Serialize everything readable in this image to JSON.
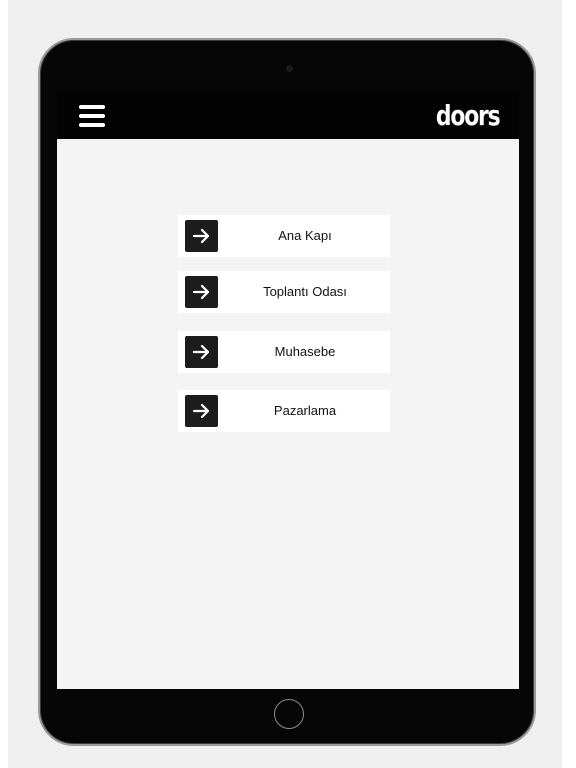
{
  "app": {
    "brand": "doors"
  },
  "header": {
    "menu_icon": "hamburger-menu-icon"
  },
  "doors": [
    {
      "label": "Ana Kapı",
      "icon": "arrow-right-icon"
    },
    {
      "label": "Toplantı Odası",
      "icon": "arrow-right-icon"
    },
    {
      "label": "Muhasebe",
      "icon": "arrow-right-icon"
    },
    {
      "label": "Pazarlama",
      "icon": "arrow-right-icon"
    }
  ],
  "colors": {
    "screen_background": "#f4f4f4",
    "topbar": "#030303",
    "item_background": "#ffffff",
    "arrow_button": "#1c1c1c"
  }
}
